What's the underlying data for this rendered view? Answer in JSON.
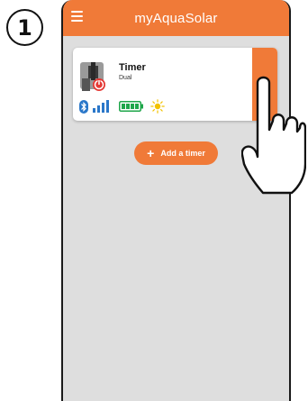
{
  "step": {
    "number": "1"
  },
  "app": {
    "title": "myAquaSolar"
  },
  "timer_card": {
    "title": "Timer",
    "subtitle": "Dual"
  },
  "status_icons": [
    "bluetooth-icon",
    "signal-strength-icon",
    "battery-icon",
    "sun-icon"
  ],
  "actions": {
    "add_timer_label": "Add a timer"
  },
  "colors": {
    "accent": "#f07a38",
    "background": "#dedede",
    "bluetooth": "#2a77c9",
    "battery": "#1ea64a",
    "sun": "#f2c200"
  }
}
